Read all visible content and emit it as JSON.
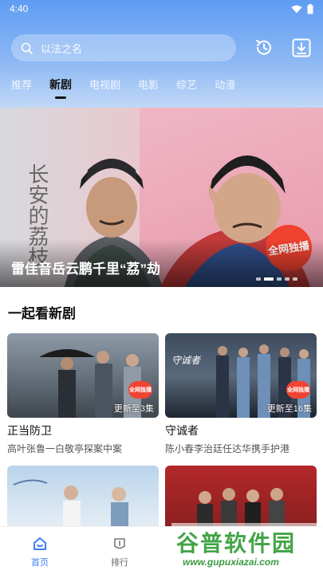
{
  "status": {
    "time": "4:40"
  },
  "search": {
    "placeholder": "以法之名"
  },
  "tabs": [
    {
      "label": "推荐"
    },
    {
      "label": "新剧"
    },
    {
      "label": "电视剧"
    },
    {
      "label": "电影"
    },
    {
      "label": "综艺"
    },
    {
      "label": "动漫"
    }
  ],
  "banner": {
    "title": "雷佳音岳云鹏千里“荔”劫",
    "badge": "全网独播",
    "calligraphy": "长安的荔枝",
    "active_slide_index": 1,
    "slide_count": 5
  },
  "section": {
    "title": "一起看新剧"
  },
  "cards": [
    {
      "title": "正当防卫",
      "desc": "高叶张鲁一白敬亭探案中案",
      "episodes": "更新至3集",
      "badge": "全网独播"
    },
    {
      "title": "守诚者",
      "desc": "陈小春李治廷任达华携手护港",
      "episodes": "更新至16集",
      "badge": "全网独播"
    },
    {
      "title": "",
      "desc": "",
      "episodes": "",
      "badge": ""
    },
    {
      "title": "",
      "desc": "",
      "episodes": "",
      "badge": ""
    }
  ],
  "nav": [
    {
      "label": "首页",
      "icon": "home-icon"
    },
    {
      "label": "排行",
      "icon": "ranking-icon"
    }
  ],
  "watermark": {
    "main": "谷普软件园",
    "url": "www.gupuxiazai.com"
  },
  "colors": {
    "accent": "#3a7ff0",
    "header_top": "#5f9cf2",
    "badge_red": "#f0412f"
  }
}
